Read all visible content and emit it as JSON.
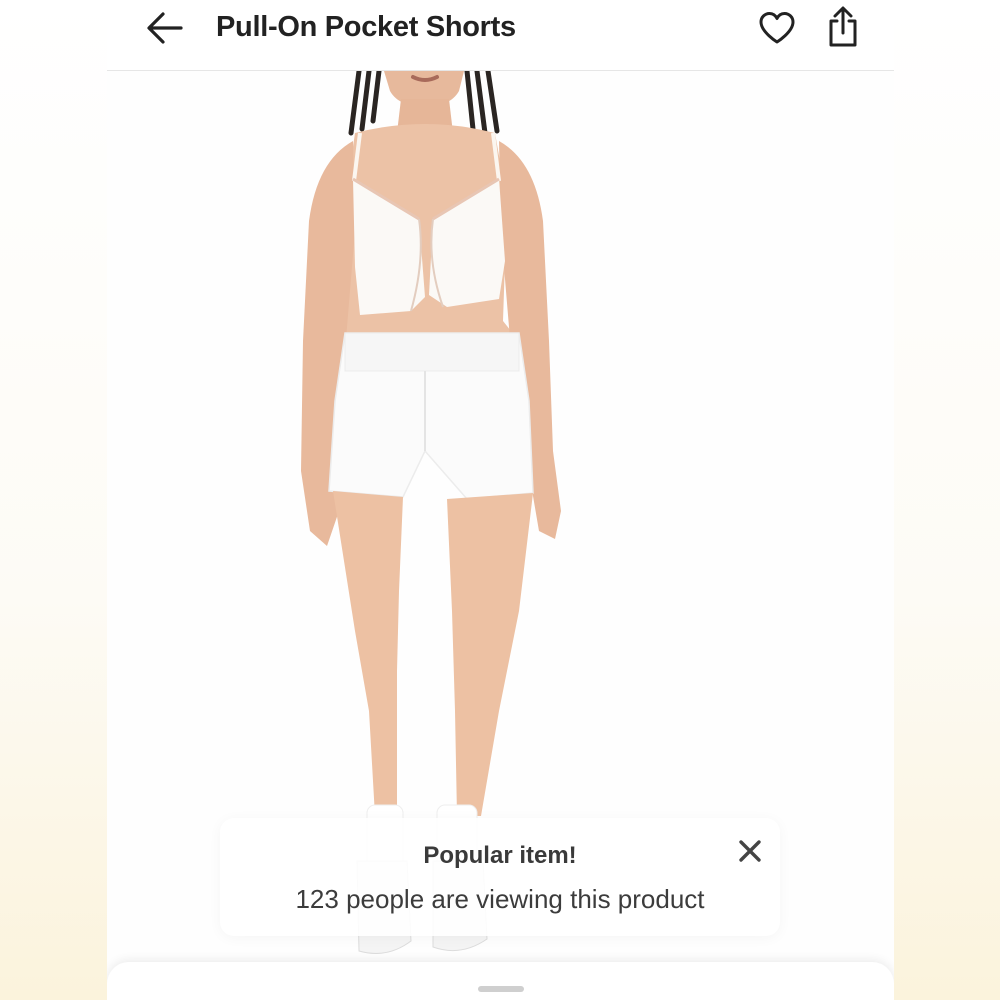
{
  "header": {
    "title": "Pull-On Pocket Shorts",
    "back_icon": "arrow-left-icon",
    "favorite_icon": "heart-outline-icon",
    "share_icon": "share-icon"
  },
  "toast": {
    "title": "Popular item!",
    "message": "123 people are viewing this product",
    "close_icon": "close-icon"
  },
  "colors": {
    "text": "#222222",
    "background": "#ffffff",
    "page_bg": "#fbf3dc"
  }
}
